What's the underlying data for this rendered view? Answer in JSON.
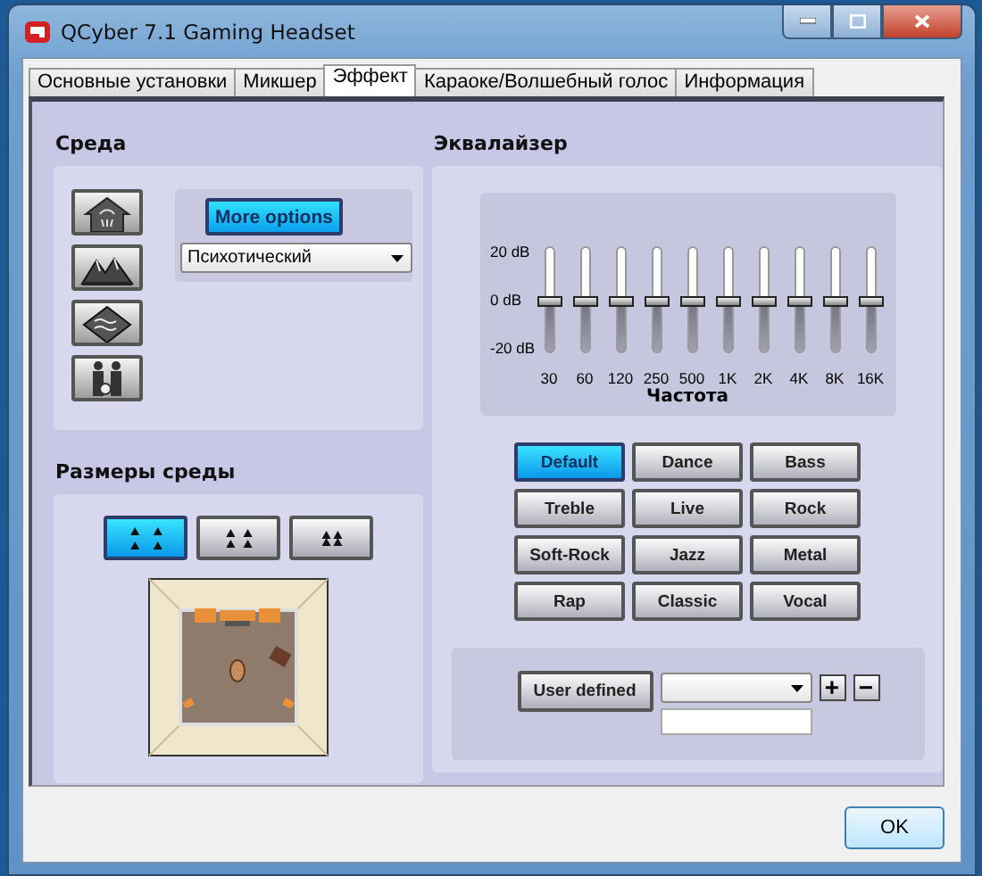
{
  "window": {
    "title": "QCyber 7.1 Gaming Headset"
  },
  "tabs": [
    {
      "label": "Основные установки",
      "selected": false
    },
    {
      "label": "Микшер",
      "selected": false
    },
    {
      "label": "Эффект",
      "selected": true
    },
    {
      "label": "Караоке/Волшебный голос",
      "selected": false
    },
    {
      "label": "Информация",
      "selected": false
    }
  ],
  "environment": {
    "heading": "Среда",
    "more_options": "More options",
    "preset": "Психотический"
  },
  "environment_size": {
    "heading": "Размеры среды",
    "sizes": [
      {
        "selected": true
      },
      {
        "selected": false
      },
      {
        "selected": false
      }
    ]
  },
  "equalizer": {
    "heading": "Эквалайзер",
    "scale": [
      "20 dB",
      "0 dB",
      "-20 dB"
    ],
    "bands": [
      {
        "label": "30",
        "level": 0.5
      },
      {
        "label": "60",
        "level": 0.5
      },
      {
        "label": "120",
        "level": 0.5
      },
      {
        "label": "250",
        "level": 0.5
      },
      {
        "label": "500",
        "level": 0.5
      },
      {
        "label": "1K",
        "level": 0.5
      },
      {
        "label": "2K",
        "level": 0.5
      },
      {
        "label": "4K",
        "level": 0.5
      },
      {
        "label": "8K",
        "level": 0.5
      },
      {
        "label": "16K",
        "level": 0.5
      }
    ],
    "axis_label": "Частота",
    "presets": [
      {
        "label": "Default",
        "selected": true
      },
      {
        "label": "Dance",
        "selected": false
      },
      {
        "label": "Bass",
        "selected": false
      },
      {
        "label": "Treble",
        "selected": false
      },
      {
        "label": "Live",
        "selected": false
      },
      {
        "label": "Rock",
        "selected": false
      },
      {
        "label": "Soft-Rock",
        "selected": false
      },
      {
        "label": "Jazz",
        "selected": false
      },
      {
        "label": "Metal",
        "selected": false
      },
      {
        "label": "Rap",
        "selected": false
      },
      {
        "label": "Classic",
        "selected": false
      },
      {
        "label": "Vocal",
        "selected": false
      }
    ],
    "user_defined": "User defined",
    "add": "+",
    "remove": "−"
  },
  "ok_button": "OK"
}
